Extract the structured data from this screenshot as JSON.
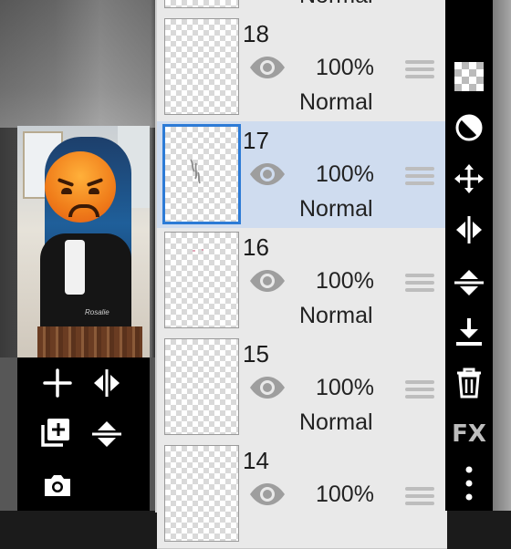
{
  "preview": {
    "signature": "Rosalie"
  },
  "layers": [
    {
      "number": "",
      "opacity": "",
      "blend": "Normal",
      "selected": false
    },
    {
      "number": "18",
      "opacity": "100%",
      "blend": "Normal",
      "selected": false
    },
    {
      "number": "17",
      "opacity": "100%",
      "blend": "Normal",
      "selected": true
    },
    {
      "number": "16",
      "opacity": "100%",
      "blend": "Normal",
      "selected": false
    },
    {
      "number": "15",
      "opacity": "100%",
      "blend": "Normal",
      "selected": false
    },
    {
      "number": "14",
      "opacity": "100%",
      "blend": "",
      "selected": false
    }
  ],
  "toolbar": {
    "fx_label": "FX"
  },
  "colors": {
    "selected_row": "#cfdcef",
    "selected_border": "#2d7bd6"
  }
}
